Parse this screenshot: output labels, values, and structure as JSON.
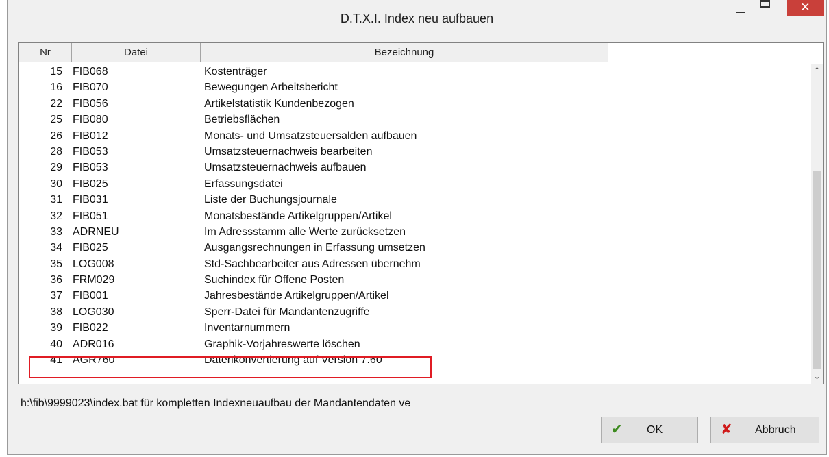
{
  "window": {
    "title": "D.T.X.I.  Index neu aufbauen",
    "minimize_glyph": "minimize-icon",
    "maximize_glyph": "maximize-icon",
    "close_glyph": "✕"
  },
  "list": {
    "columns": [
      "Nr",
      "Datei",
      "Bezeichnung"
    ],
    "rows": [
      {
        "nr": "15",
        "datei": "FIB068",
        "bezeichnung": "Kostenträger"
      },
      {
        "nr": "16",
        "datei": "FIB070",
        "bezeichnung": "Bewegungen Arbeitsbericht"
      },
      {
        "nr": "22",
        "datei": "FIB056",
        "bezeichnung": "Artikelstatistik Kundenbezogen"
      },
      {
        "nr": "25",
        "datei": "FIB080",
        "bezeichnung": "Betriebsflächen"
      },
      {
        "nr": "26",
        "datei": "FIB012",
        "bezeichnung": "Monats- und Umsatzsteuersalden aufbauen"
      },
      {
        "nr": "28",
        "datei": "FIB053",
        "bezeichnung": "Umsatzsteuernachweis bearbeiten"
      },
      {
        "nr": "29",
        "datei": "FIB053",
        "bezeichnung": "Umsatzsteuernachweis aufbauen"
      },
      {
        "nr": "30",
        "datei": "FIB025",
        "bezeichnung": "Erfassungsdatei"
      },
      {
        "nr": "31",
        "datei": "FIB031",
        "bezeichnung": "Liste der Buchungsjournale"
      },
      {
        "nr": "32",
        "datei": "FIB051",
        "bezeichnung": "Monatsbestände Artikelgruppen/Artikel"
      },
      {
        "nr": "33",
        "datei": "ADRNEU",
        "bezeichnung": "Im Adressstamm alle Werte zurücksetzen"
      },
      {
        "nr": "34",
        "datei": "FIB025",
        "bezeichnung": "Ausgangsrechnungen in Erfassung umsetzen"
      },
      {
        "nr": "35",
        "datei": "LOG008",
        "bezeichnung": "Std-Sachbearbeiter aus Adressen übernehm"
      },
      {
        "nr": "36",
        "datei": "FRM029",
        "bezeichnung": "Suchindex für Offene Posten"
      },
      {
        "nr": "37",
        "datei": "FIB001",
        "bezeichnung": "Jahresbestände Artikelgruppen/Artikel"
      },
      {
        "nr": "38",
        "datei": "LOG030",
        "bezeichnung": "Sperr-Datei für Mandantenzugriffe"
      },
      {
        "nr": "39",
        "datei": "FIB022",
        "bezeichnung": "Inventarnummern"
      },
      {
        "nr": "40",
        "datei": "ADR016",
        "bezeichnung": "Graphik-Vorjahreswerte löschen"
      },
      {
        "nr": "41",
        "datei": "AGR760",
        "bezeichnung": "Datenkonvertierung auf Version 7.60"
      }
    ],
    "highlighted_row": "41",
    "highlight_color": "#e01c24"
  },
  "status_text": "h:\\fib\\9999023\\index.bat für kompletten Indexneuaufbau der Mandantendaten ve",
  "buttons": {
    "ok": {
      "label": "OK",
      "icon": "checkmark-icon",
      "icon_color": "#3c8a1e"
    },
    "cancel": {
      "label": "Abbruch",
      "icon": "x-icon",
      "icon_color": "#d01a1a"
    }
  }
}
